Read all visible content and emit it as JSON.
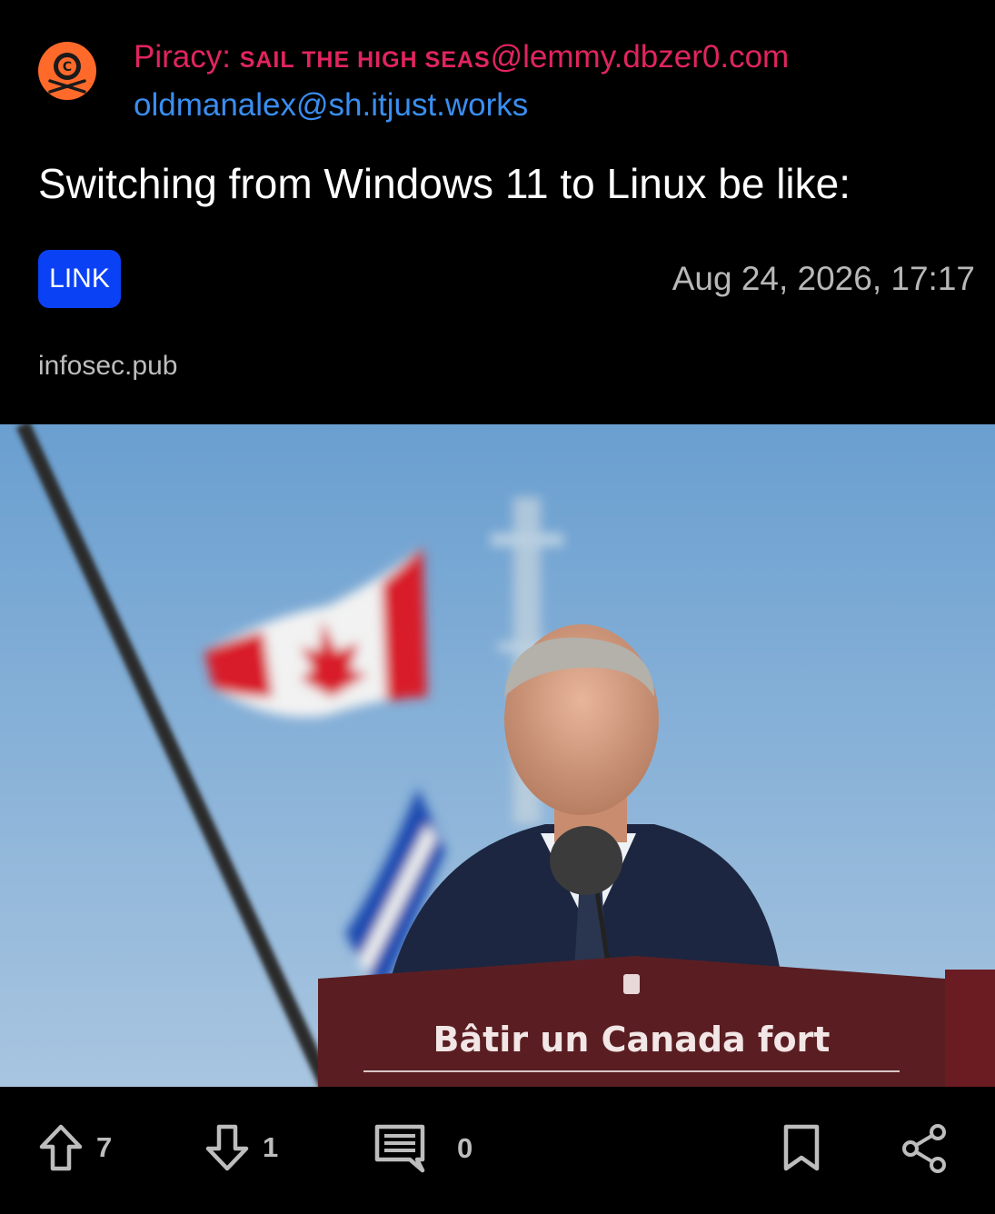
{
  "community": {
    "name_prefix": "Piracy:",
    "name_smallcaps": "Sail the High Seas",
    "instance": "@lemmy.dbzer0.com",
    "icon": "skull-crossbones-copyright-icon",
    "icon_color": "#ff6a2b"
  },
  "author": {
    "username": "oldmanalex",
    "instance": "@sh.itjust.works"
  },
  "post": {
    "title": "Switching from Windows 11 to Linux be like:",
    "type_badge": "LINK",
    "timestamp": "Aug 24, 2026, 17:17",
    "domain": "infosec.pub"
  },
  "image": {
    "podium_text": "Bâtir un Canada fort"
  },
  "actions": {
    "upvotes": "7",
    "downvotes": "1",
    "comments": "0"
  },
  "colors": {
    "community": "#e0255e",
    "username": "#3a8ef0",
    "badge": "#0a41f5",
    "muted": "#bdbdbd"
  }
}
